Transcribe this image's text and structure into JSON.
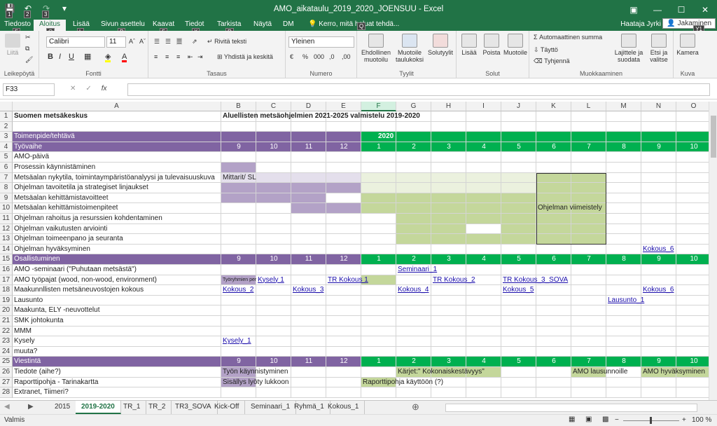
{
  "window": {
    "title": "AMO_aikataulu_2019_2020_JOENSUU - Excel",
    "keytips": [
      "1",
      "2",
      "3"
    ]
  },
  "tabs": [
    {
      "label": "Tiedosto",
      "key": "F"
    },
    {
      "label": "Aloitus",
      "key": "O"
    },
    {
      "label": "Lisää",
      "key": "L"
    },
    {
      "label": "Sivun asettelu",
      "key": "P"
    },
    {
      "label": "Kaavat",
      "key": "F"
    },
    {
      "label": "Tiedot",
      "key": "X"
    },
    {
      "label": "Tarkista",
      "key": "R"
    },
    {
      "label": "Näytä",
      "key": "W"
    },
    {
      "label": "DM",
      "key": "Y"
    }
  ],
  "tellme": {
    "label": "Kerro, mitä haluat tehdä...",
    "key": "Q"
  },
  "user": {
    "name": "Haataja Jyrki",
    "share": "Jakaminen",
    "share_key": "Y1"
  },
  "ribbon": {
    "clipboard": {
      "label": "Leikepöytä",
      "paste": "Liitä"
    },
    "font": {
      "label": "Fontti",
      "name": "Calibri",
      "size": "11"
    },
    "alignment": {
      "label": "Tasaus",
      "wrap": "Rivitä teksti",
      "merge": "Yhdistä ja keskitä"
    },
    "number": {
      "label": "Numero",
      "format": "Yleinen"
    },
    "styles": {
      "label": "Tyylit",
      "cond1": "Ehdollinen",
      "cond2": "muotoilu",
      "table1": "Muotoile",
      "table2": "taulukoksi",
      "cell1": "Solutyylit"
    },
    "cells": {
      "label": "Solut",
      "insert": "Lisää",
      "delete": "Poista",
      "format": "Muotoile"
    },
    "editing": {
      "label": "Muokkaaminen",
      "autosum": "Automaattinen summa",
      "fill": "Täyttö",
      "clear": "Tyhjennä",
      "sort1": "Lajittele ja",
      "sort2": "suodata",
      "find1": "Etsi ja",
      "find2": "valitse"
    },
    "camera": {
      "label": "Kuva",
      "btn": "Kamera"
    }
  },
  "formula": {
    "namebox": "F33",
    "value": ""
  },
  "columns": [
    "A",
    "B",
    "C",
    "D",
    "E",
    "F",
    "G",
    "H",
    "I",
    "J",
    "K",
    "L",
    "M",
    "N",
    "O"
  ],
  "rows": {
    "r1": {
      "a": "Suomen metsäkeskus",
      "b": "Aluellisten metsäohjelmien 2021-2025 valmistelu 2019-2020"
    },
    "r3": {
      "a": "Toimenpide/tehtävä",
      "f": "2020"
    },
    "r4": {
      "a": "Työvaihe"
    },
    "r5": {
      "a": "AMO-päivä"
    },
    "r6": {
      "a": "Prosessin käynnistäminen"
    },
    "r7": {
      "a": "Metsäalan nykytila, toimintaympäristöanalyysi ja tulevaisuuskuva",
      "b": "Mittarit/ SL"
    },
    "r8": {
      "a": "Ohjelman tavoitetila ja strategiset linjaukset"
    },
    "r9": {
      "a": "Metsäalan kehittämistavoitteet"
    },
    "r10": {
      "a": "Metsäalan kehittämistoimenpiteet",
      "k": "Ohjelman viimeistely"
    },
    "r11": {
      "a": "Ohjelman rahoitus ja resurssien kohdentaminen"
    },
    "r12": {
      "a": "Ohjelman vaikutusten arviointi"
    },
    "r13": {
      "a": "Ohjelman toimeenpano ja seuranta"
    },
    "r14": {
      "a": "Ohjelman hyväksyminen",
      "n": "Kokous_6"
    },
    "r15": {
      "a": "Osallistuminen"
    },
    "r16": {
      "a": "AMO -seminaari (\"Puhutaan metsästä\")",
      "g": "Seminaari_1"
    },
    "r17": {
      "a": "AMO työpajat (wood, non-wood, environment)",
      "b": "Työryhmien perustaminen",
      "c": "Kysely 1",
      "e": "TR Kokous 1",
      "h": "TR Kokous_2",
      "j": "TR Kokous_3_SOVA"
    },
    "r18": {
      "a": "Maakunnllisten metsäneuvostojen kokous",
      "b": "Kokous_2",
      "d": "Kokous_3",
      "g": "Kokous_4",
      "j": "Kokous_5",
      "n": "Kokous_6"
    },
    "r19": {
      "a": "Lausunto",
      "m": "Lausunto_1"
    },
    "r20": {
      "a": "Maakunta, ELY -neuvottelut"
    },
    "r21": {
      "a": "SMK johtokunta"
    },
    "r22": {
      "a": "MMM"
    },
    "r23": {
      "a": "Kysely",
      "b": "Kysely_1"
    },
    "r24": {
      "a": "muuta?"
    },
    "r25": {
      "a": "Viestintä"
    },
    "r26": {
      "a": "Tiedote (aihe?)",
      "b": "Työn käynnistyminen",
      "g": "Kärjet:\" Kokonaiskestävyys\"",
      "l": "AMO lausunnoille",
      "n": "AMO hyväksyminen"
    },
    "r27": {
      "a": "Raportti­pohja - Tarinakartta",
      "b": "Sisällys lyöty lukkoon",
      "f": "Raporttipohja käyttöön (?)"
    },
    "r28": {
      "a": "Extranet, Tiimeri?"
    }
  },
  "months": [
    "9",
    "10",
    "11",
    "12",
    "1",
    "2",
    "3",
    "4",
    "5",
    "6",
    "7",
    "8",
    "9",
    "10"
  ],
  "sheets": [
    "2015",
    "2019-2020",
    "TR_1",
    "TR_2",
    "TR3_SOVA",
    "Kick-Off",
    "Seminaari_1",
    "Ryhmä_1",
    "Kokous_1"
  ],
  "status": {
    "left": "Valmis",
    "zoom": "100 %"
  },
  "colors": {
    "excel_green": "#217346",
    "header_purple": "#8064a2",
    "light_purple": "#b3a2c7",
    "pale_purple": "#e4dfec",
    "green_band": "#00b050",
    "light_green": "#c4d79b",
    "pale_green": "#ebf1de"
  }
}
